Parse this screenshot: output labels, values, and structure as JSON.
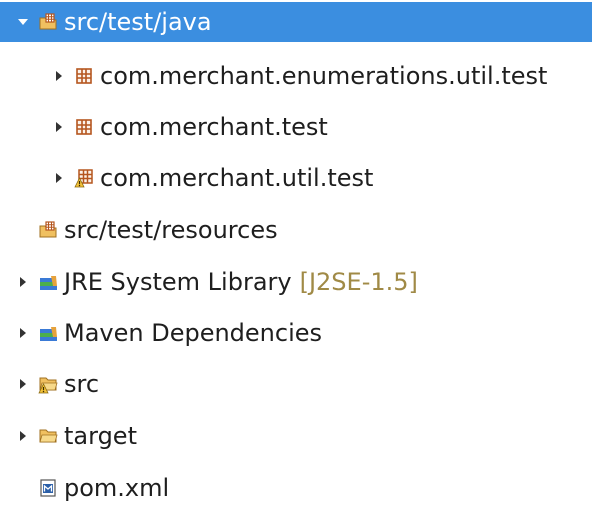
{
  "tree": {
    "items": [
      {
        "label": "src/test/java",
        "expanded": true,
        "selected": true,
        "icon": "package-folder-icon"
      },
      {
        "label": "com.merchant.enumerations.util.test",
        "expanded": false,
        "icon": "package-icon"
      },
      {
        "label": "com.merchant.test",
        "expanded": false,
        "icon": "package-icon"
      },
      {
        "label": "com.merchant.util.test",
        "expanded": false,
        "icon": "package-warning-icon"
      },
      {
        "label": "src/test/resources",
        "icon": "package-folder-icon"
      },
      {
        "label": "JRE System Library",
        "decoration": "[J2SE-1.5]",
        "expanded": false,
        "icon": "library-icon"
      },
      {
        "label": "Maven Dependencies",
        "expanded": false,
        "icon": "library-icon"
      },
      {
        "label": "src",
        "expanded": false,
        "icon": "folder-warning-icon"
      },
      {
        "label": "target",
        "expanded": false,
        "icon": "folder-icon"
      },
      {
        "label": "pom.xml",
        "icon": "maven-file-icon"
      }
    ]
  },
  "colors": {
    "selection": "#3b8ee0",
    "decoration": "#a08a46",
    "package": "#b5561f",
    "folder": "#e8b452"
  }
}
